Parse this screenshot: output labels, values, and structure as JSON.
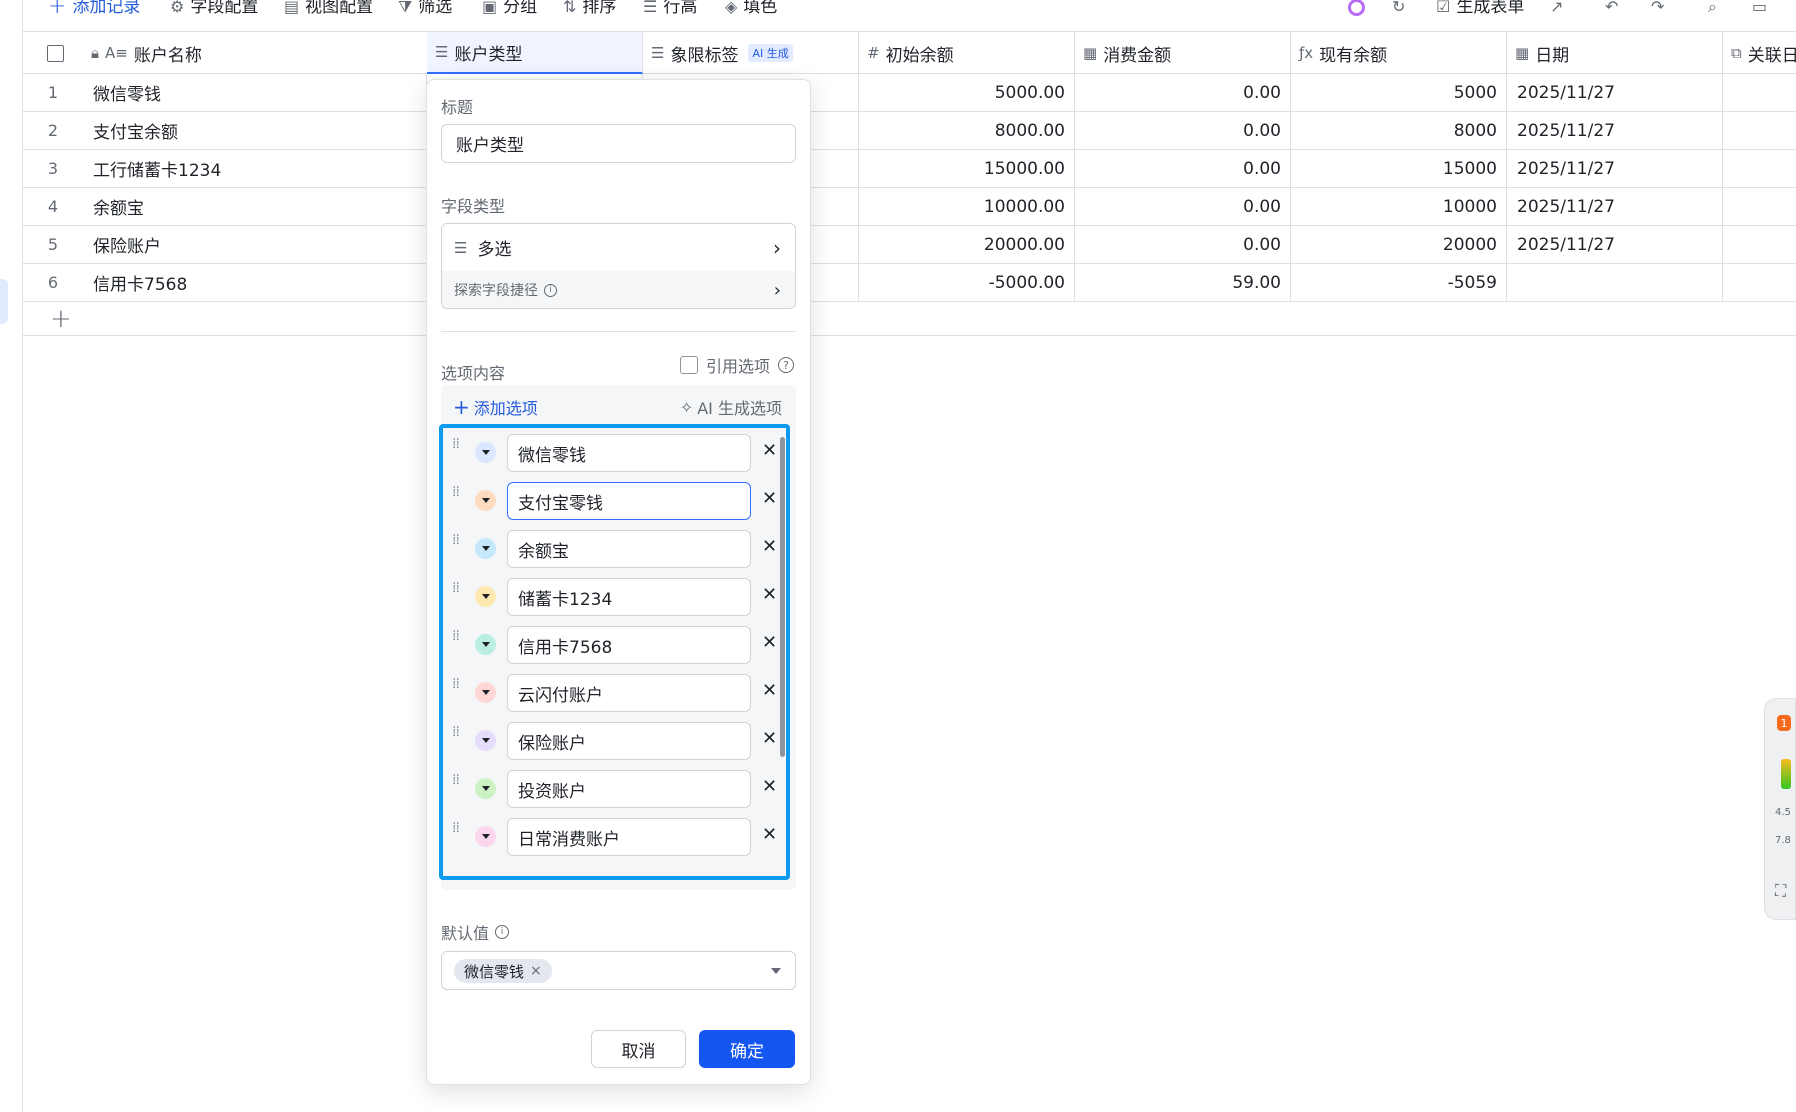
{
  "toolbar": {
    "add_record": "添加记录",
    "field_config": "字段配置",
    "view_config": "视图配置",
    "filter": "筛选",
    "group": "分组",
    "sort": "排序",
    "row_height": "行高",
    "fill_color": "填色",
    "generate_form": "生成表单"
  },
  "columns": [
    "账户名称",
    "账户类型",
    "象限标签",
    "初始余额",
    "消费金额",
    "现有余额",
    "日期",
    "关联日"
  ],
  "ai_badge": "AI 生成",
  "rows": [
    {
      "idx": "1",
      "name": "微信零钱",
      "initial": "5000.00",
      "spent": "0.00",
      "current": "5000",
      "date": "2025/11/27"
    },
    {
      "idx": "2",
      "name": "支付宝余额",
      "initial": "8000.00",
      "spent": "0.00",
      "current": "8000",
      "date": "2025/11/27"
    },
    {
      "idx": "3",
      "name": "工行储蓄卡1234",
      "initial": "15000.00",
      "spent": "0.00",
      "current": "15000",
      "date": "2025/11/27"
    },
    {
      "idx": "4",
      "name": "余额宝",
      "initial": "10000.00",
      "spent": "0.00",
      "current": "10000",
      "date": "2025/11/27"
    },
    {
      "idx": "5",
      "name": "保险账户",
      "initial": "20000.00",
      "spent": "0.00",
      "current": "20000",
      "date": "2025/11/27"
    },
    {
      "idx": "6",
      "name": "信用卡7568",
      "initial": "-5000.00",
      "spent": "59.00",
      "current": "-5059",
      "date": ""
    }
  ],
  "panel": {
    "title_label": "标题",
    "title_value": "账户类型",
    "field_type_label": "字段类型",
    "field_type_value": "多选",
    "explore_shortcut": "探索字段捷径",
    "options_label": "选项内容",
    "reference_options": "引用选项",
    "add_option": "添加选项",
    "ai_generate": "AI 生成选项",
    "options": [
      {
        "label": "微信零钱",
        "color": "#dbe6ff"
      },
      {
        "label": "支付宝零钱",
        "color": "#fddbbf"
      },
      {
        "label": "余额宝",
        "color": "#c6e8fb"
      },
      {
        "label": "储蓄卡1234",
        "color": "#fde9b0"
      },
      {
        "label": "信用卡7568",
        "color": "#b9eee0"
      },
      {
        "label": "云闪付账户",
        "color": "#fcd7d6"
      },
      {
        "label": "保险账户",
        "color": "#e6dcfb"
      },
      {
        "label": "投资账户",
        "color": "#ccf2c4"
      },
      {
        "label": "日常消费账户",
        "color": "#fbd6ec"
      }
    ],
    "default_label": "默认值",
    "default_tag": "微信零钱",
    "cancel": "取消",
    "confirm": "确定"
  },
  "widget": {
    "badge": "1",
    "up": "4.5",
    "down": "7.8"
  }
}
